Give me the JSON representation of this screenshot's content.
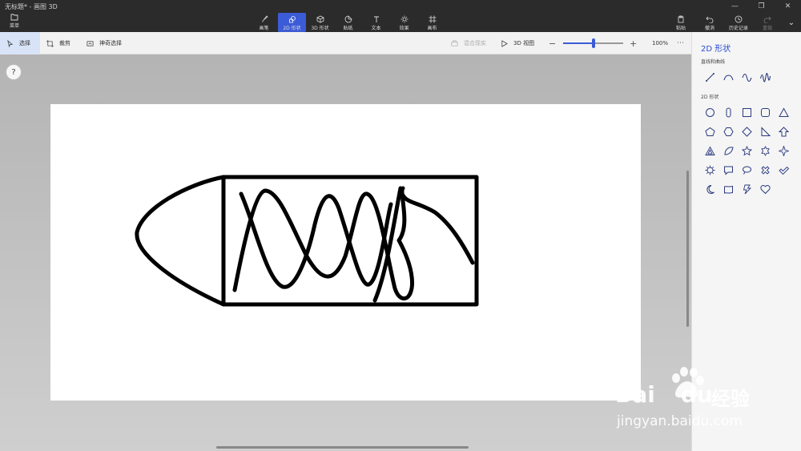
{
  "window": {
    "title": "无标题* - 画图 3D"
  },
  "menu": {
    "label": "菜单"
  },
  "tools": [
    {
      "label": "画笔",
      "icon": "brush-icon"
    },
    {
      "label": "2D 形状",
      "icon": "2d-shapes-icon",
      "active": true
    },
    {
      "label": "3D 形状",
      "icon": "3d-shapes-icon"
    },
    {
      "label": "贴纸",
      "icon": "sticker-icon"
    },
    {
      "label": "文本",
      "icon": "text-icon"
    },
    {
      "label": "效果",
      "icon": "effects-icon"
    },
    {
      "label": "画布",
      "icon": "canvas-icon"
    }
  ],
  "right_tools": [
    {
      "label": "粘贴",
      "icon": "paste-icon"
    },
    {
      "label": "撤消",
      "icon": "undo-icon"
    },
    {
      "label": "历史记录",
      "icon": "history-icon"
    },
    {
      "label": "重做",
      "icon": "redo-icon",
      "disabled": true
    }
  ],
  "subbar": {
    "select": "选择",
    "crop": "裁剪",
    "magic_select": "神奇选择",
    "mixed_reality": "混合现实",
    "view_3d": "3D 视图",
    "zoom_percent": "100%",
    "zoom_level": 0.5
  },
  "help": {
    "label": "?"
  },
  "panel": {
    "title": "2D 形状",
    "lines_section": "直线和曲线",
    "shapes_section": "2D 形状",
    "line_shapes": [
      "line-icon",
      "curve-icon",
      "wave-icon",
      "zigzag-wave-icon"
    ],
    "shapes": [
      "circle-icon",
      "capsule-icon",
      "square-icon",
      "rounded-square-icon",
      "triangle-icon",
      "pentagon-icon",
      "hexagon-icon",
      "diamond-icon",
      "right-triangle-icon",
      "arrow-up-icon",
      "triangle-outline-icon",
      "leaf-icon",
      "star5-icon",
      "star6-icon",
      "star4-icon",
      "burst-icon",
      "speech-bubble-icon",
      "thought-bubble-icon",
      "x-icon",
      "check-icon",
      "moon-icon",
      "banner-icon",
      "lightning-icon",
      "heart-icon"
    ]
  },
  "watermark": {
    "brand": "Bai",
    "brand2": "du",
    "cn": "经验",
    "url": "jingyan.baidu.com"
  },
  "colors": {
    "accent": "#3c5bd6",
    "titlebar": "#2b2b2b",
    "panel_title": "#2a4bd0"
  }
}
